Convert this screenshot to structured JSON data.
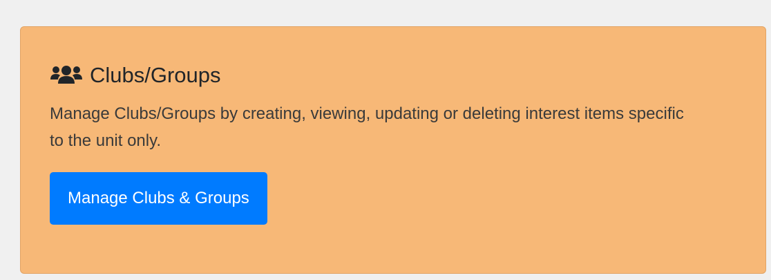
{
  "card": {
    "icon": "users-icon",
    "title": "Clubs/Groups",
    "description": "Manage Clubs/Groups by creating, viewing, updating or deleting interest items specific to the unit only.",
    "button_label": "Manage Clubs & Groups"
  },
  "colors": {
    "page_background": "#f0f0f0",
    "card_background": "#f7b877",
    "card_border": "#e2a364",
    "primary_button": "#007bff",
    "text": "#212529"
  }
}
